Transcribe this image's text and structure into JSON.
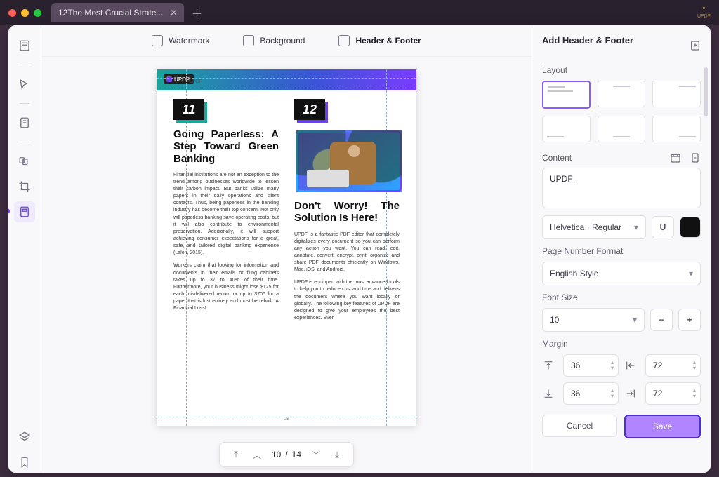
{
  "tab": {
    "title": "12The Most Crucial Strate..."
  },
  "topseg": {
    "watermark": "Watermark",
    "background": "Background",
    "headerfooter": "Header & Footer"
  },
  "pager": {
    "current": "10",
    "sep": "/",
    "total": "14"
  },
  "doc": {
    "brand": "UPDF",
    "header_text": "UPDF",
    "page_number": "08",
    "left": {
      "num": "11",
      "title": "Going Paperless: A Step Toward Green Banking",
      "p1": "Financial institutions are not an exception to the trend among businesses worldwide to lessen their carbon impact. But banks utilize many papers in their daily operations and client contacts. Thus, being paperless in the banking industry has become their top concern. Not only will paperless banking save operating costs, but it will also contribute to environmental preservation. Additionally, it will support achieving consumer expectations for a great, safe, and tailored digital banking experience (Lalon, 2015).",
      "p2": "Workers claim that looking for information and documents in their emails or filing cabinets takes up to 37 to 40% of their time. Furthermore, your business might lose $125 for each misdelivered record or up to $700 for a paper that is lost entirely and must be rebuilt. A Financial Loss!"
    },
    "right": {
      "num": "12",
      "title": "Don't Worry! The Solution Is Here!",
      "p1": "UPDF is a fantastic PDF editor that completely digitalizes every document so you can perform any action you want. You can read, edit, annotate, convert, encrypt, print, organize and share PDF documents efficiently on Windows, Mac, iOS, and Android.",
      "p2": "UPDF is equipped with the most advanced tools to help you to reduce cost and time and delivers the document where you want locally or globally. The following key features of UPDF are designed to give your employees the best experiences. Ever."
    }
  },
  "side": {
    "title": "Add Header & Footer",
    "layout_label": "Layout",
    "content_label": "Content",
    "content_value": "UPDF",
    "font_label": "Helvetica · Regular",
    "underline": "U",
    "pagefmt_label": "Page Number Format",
    "pagefmt_value": "English Style",
    "fontsize_label": "Font Size",
    "fontsize_value": "10",
    "margin_label": "Margin",
    "margin_top": "36",
    "margin_right": "72",
    "margin_bottom": "36",
    "margin_left": "72",
    "cancel": "Cancel",
    "save": "Save"
  }
}
